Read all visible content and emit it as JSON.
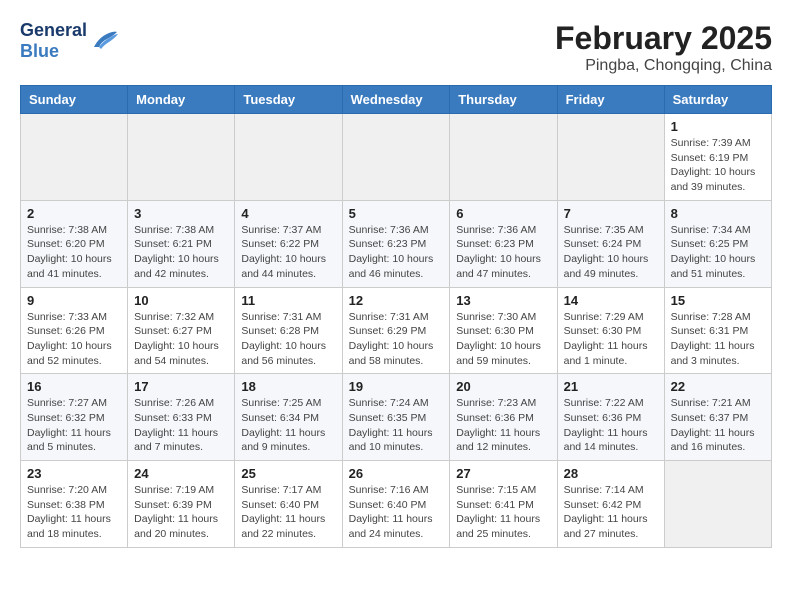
{
  "brand": {
    "name_general": "General",
    "name_blue": "Blue"
  },
  "title": "February 2025",
  "subtitle": "Pingba, Chongqing, China",
  "weekdays": [
    "Sunday",
    "Monday",
    "Tuesday",
    "Wednesday",
    "Thursday",
    "Friday",
    "Saturday"
  ],
  "weeks": [
    [
      {
        "day": "",
        "info": ""
      },
      {
        "day": "",
        "info": ""
      },
      {
        "day": "",
        "info": ""
      },
      {
        "day": "",
        "info": ""
      },
      {
        "day": "",
        "info": ""
      },
      {
        "day": "",
        "info": ""
      },
      {
        "day": "1",
        "info": "Sunrise: 7:39 AM\nSunset: 6:19 PM\nDaylight: 10 hours and 39 minutes."
      }
    ],
    [
      {
        "day": "2",
        "info": "Sunrise: 7:38 AM\nSunset: 6:20 PM\nDaylight: 10 hours and 41 minutes."
      },
      {
        "day": "3",
        "info": "Sunrise: 7:38 AM\nSunset: 6:21 PM\nDaylight: 10 hours and 42 minutes."
      },
      {
        "day": "4",
        "info": "Sunrise: 7:37 AM\nSunset: 6:22 PM\nDaylight: 10 hours and 44 minutes."
      },
      {
        "day": "5",
        "info": "Sunrise: 7:36 AM\nSunset: 6:23 PM\nDaylight: 10 hours and 46 minutes."
      },
      {
        "day": "6",
        "info": "Sunrise: 7:36 AM\nSunset: 6:23 PM\nDaylight: 10 hours and 47 minutes."
      },
      {
        "day": "7",
        "info": "Sunrise: 7:35 AM\nSunset: 6:24 PM\nDaylight: 10 hours and 49 minutes."
      },
      {
        "day": "8",
        "info": "Sunrise: 7:34 AM\nSunset: 6:25 PM\nDaylight: 10 hours and 51 minutes."
      }
    ],
    [
      {
        "day": "9",
        "info": "Sunrise: 7:33 AM\nSunset: 6:26 PM\nDaylight: 10 hours and 52 minutes."
      },
      {
        "day": "10",
        "info": "Sunrise: 7:32 AM\nSunset: 6:27 PM\nDaylight: 10 hours and 54 minutes."
      },
      {
        "day": "11",
        "info": "Sunrise: 7:31 AM\nSunset: 6:28 PM\nDaylight: 10 hours and 56 minutes."
      },
      {
        "day": "12",
        "info": "Sunrise: 7:31 AM\nSunset: 6:29 PM\nDaylight: 10 hours and 58 minutes."
      },
      {
        "day": "13",
        "info": "Sunrise: 7:30 AM\nSunset: 6:30 PM\nDaylight: 10 hours and 59 minutes."
      },
      {
        "day": "14",
        "info": "Sunrise: 7:29 AM\nSunset: 6:30 PM\nDaylight: 11 hours and 1 minute."
      },
      {
        "day": "15",
        "info": "Sunrise: 7:28 AM\nSunset: 6:31 PM\nDaylight: 11 hours and 3 minutes."
      }
    ],
    [
      {
        "day": "16",
        "info": "Sunrise: 7:27 AM\nSunset: 6:32 PM\nDaylight: 11 hours and 5 minutes."
      },
      {
        "day": "17",
        "info": "Sunrise: 7:26 AM\nSunset: 6:33 PM\nDaylight: 11 hours and 7 minutes."
      },
      {
        "day": "18",
        "info": "Sunrise: 7:25 AM\nSunset: 6:34 PM\nDaylight: 11 hours and 9 minutes."
      },
      {
        "day": "19",
        "info": "Sunrise: 7:24 AM\nSunset: 6:35 PM\nDaylight: 11 hours and 10 minutes."
      },
      {
        "day": "20",
        "info": "Sunrise: 7:23 AM\nSunset: 6:36 PM\nDaylight: 11 hours and 12 minutes."
      },
      {
        "day": "21",
        "info": "Sunrise: 7:22 AM\nSunset: 6:36 PM\nDaylight: 11 hours and 14 minutes."
      },
      {
        "day": "22",
        "info": "Sunrise: 7:21 AM\nSunset: 6:37 PM\nDaylight: 11 hours and 16 minutes."
      }
    ],
    [
      {
        "day": "23",
        "info": "Sunrise: 7:20 AM\nSunset: 6:38 PM\nDaylight: 11 hours and 18 minutes."
      },
      {
        "day": "24",
        "info": "Sunrise: 7:19 AM\nSunset: 6:39 PM\nDaylight: 11 hours and 20 minutes."
      },
      {
        "day": "25",
        "info": "Sunrise: 7:17 AM\nSunset: 6:40 PM\nDaylight: 11 hours and 22 minutes."
      },
      {
        "day": "26",
        "info": "Sunrise: 7:16 AM\nSunset: 6:40 PM\nDaylight: 11 hours and 24 minutes."
      },
      {
        "day": "27",
        "info": "Sunrise: 7:15 AM\nSunset: 6:41 PM\nDaylight: 11 hours and 25 minutes."
      },
      {
        "day": "28",
        "info": "Sunrise: 7:14 AM\nSunset: 6:42 PM\nDaylight: 11 hours and 27 minutes."
      },
      {
        "day": "",
        "info": ""
      }
    ]
  ]
}
